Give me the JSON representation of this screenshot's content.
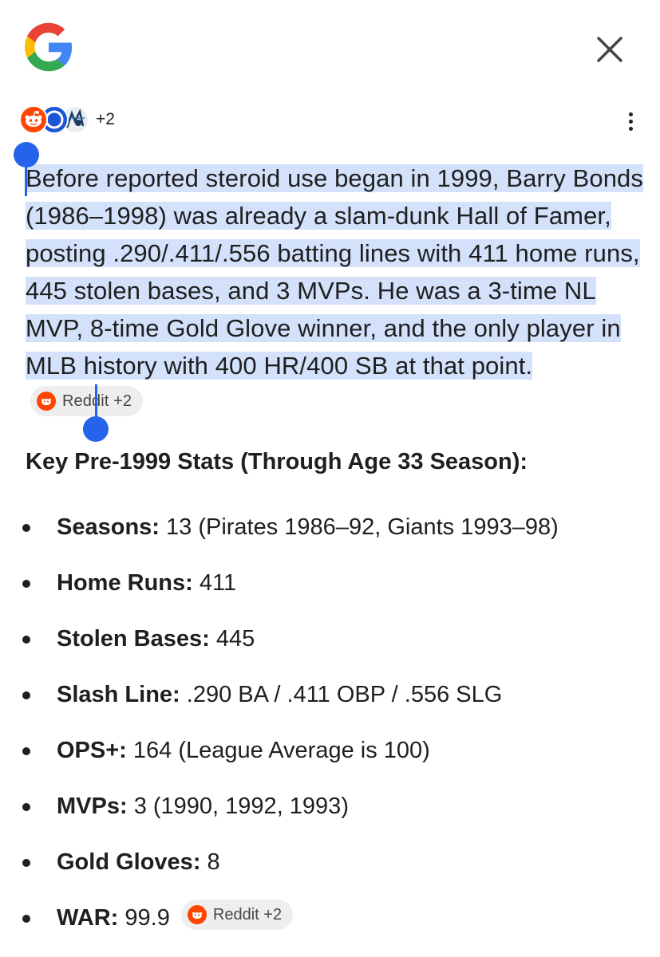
{
  "header": {
    "logo_icon": "google-g-icon",
    "close_icon": "close-icon"
  },
  "sources": {
    "icons": [
      "reddit-icon",
      "blue-site-icon",
      "artwork-site-icon"
    ],
    "extra_count": "+2",
    "menu_icon": "more-vert-icon"
  },
  "answer": {
    "selected_text": "Before reported steroid use began in 1999, Barry Bonds (1986–1998) was already a slam-dunk Hall of Famer, posting .290/.411/.556 batting lines with 411 home runs, 445 stolen bases, and 3 MVPs. He was a 3-time NL MVP, 8-time Gold Glove winner, and the only player in MLB history with 400 HR/400 SB at that point.",
    "citation_label": "Reddit +2"
  },
  "stats_heading": "Key Pre-1999 Stats (Through Age 33 Season):",
  "stats": [
    {
      "label": "Seasons:",
      "value": "13 (Pirates 1986–92, Giants 1993–98)"
    },
    {
      "label": "Home Runs:",
      "value": "411"
    },
    {
      "label": "Stolen Bases:",
      "value": "445"
    },
    {
      "label": "Slash Line:",
      "value": ".290 BA / .411 OBP / .556 SLG"
    },
    {
      "label": "OPS+:",
      "value": "164 (League Average is 100)"
    },
    {
      "label": "MVPs:",
      "value": "3 (1990, 1992, 1993)"
    },
    {
      "label": "Gold Gloves:",
      "value": "8"
    },
    {
      "label": "WAR:",
      "value": "99.9"
    }
  ],
  "stats_citation_label": "Reddit +2",
  "colors": {
    "selection": "#d3e1fb",
    "handle": "#2563eb",
    "reddit": "#ff4500",
    "chip_bg": "#eeeeee"
  }
}
